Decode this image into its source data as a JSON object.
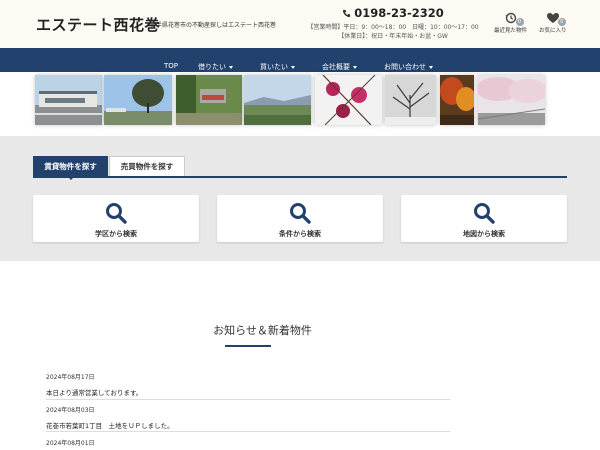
{
  "header": {
    "logo": "エステート西花巻",
    "tagline": "岩手県花巻市の不動産探しはエステート西花巻",
    "phone": "0198-23-2320",
    "hours_line1": "【営業時間】平日：9：00～18：00　日曜：10：00～17：00",
    "hours_line2": "【休業日】：祝日・年末年始・お盆・GW",
    "recent_label": "最近見た物件",
    "recent_count": "0",
    "favorites_label": "お気に入り",
    "favorites_count": "0"
  },
  "nav": {
    "items": [
      {
        "label": "TOP",
        "dropdown": false
      },
      {
        "label": "借りたい",
        "dropdown": true
      },
      {
        "label": "買いたい",
        "dropdown": true
      },
      {
        "label": "会社概要",
        "dropdown": true
      },
      {
        "label": "お問い合わせ",
        "dropdown": true
      }
    ]
  },
  "search": {
    "tabs": [
      {
        "label": "賃貸物件を探す",
        "active": true
      },
      {
        "label": "売買物件を探す",
        "active": false
      }
    ],
    "cards": [
      {
        "label": "学区から検索",
        "icon": "search-icon"
      },
      {
        "label": "条件から検索",
        "icon": "search-icon"
      },
      {
        "label": "地図から検索",
        "icon": "search-icon"
      }
    ]
  },
  "news": {
    "title": "お知らせ＆新着物件",
    "items": [
      {
        "date": "2024年08月17日",
        "text": "本日より通常営業しております。"
      },
      {
        "date": "2024年08月03日",
        "text": "花巻市若葉町1丁目　土地をＵＰしました。"
      },
      {
        "date": "2024年08月01日",
        "text": ""
      }
    ]
  },
  "colors": {
    "brand_navy": "#22416d",
    "header_bg": "#fdfaf4",
    "search_bg": "#e8e8e8"
  }
}
